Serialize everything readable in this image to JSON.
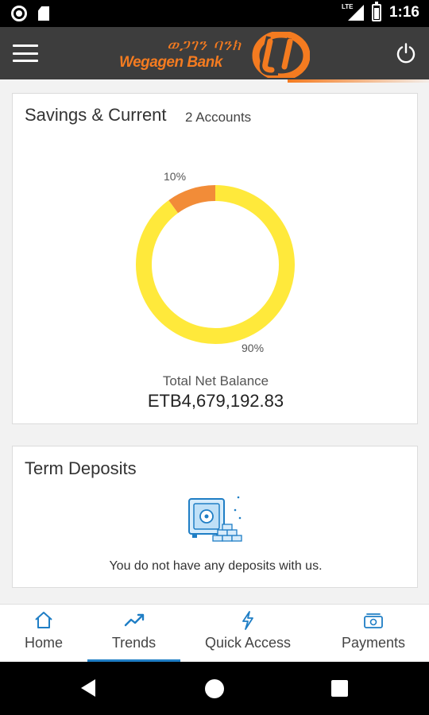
{
  "status_bar": {
    "time": "1:16",
    "network_label": "LTE",
    "icons": [
      "notification-dot-icon",
      "sd-card-icon",
      "lte-signal-icon",
      "battery-icon"
    ]
  },
  "header": {
    "amharic_name": "ወጋገን ባንክ",
    "bank_name": "Wegagen Bank",
    "menu_icon": "hamburger-menu-icon",
    "power_icon": "power-icon",
    "accent_color": "#f47b20",
    "background_color": "#3d3d3d"
  },
  "savings_card": {
    "title": "Savings & Current",
    "subtitle": "2 Accounts",
    "slices": [
      {
        "label": "10%",
        "value": 10,
        "color": "#f28c38"
      },
      {
        "label": "90%",
        "value": 90,
        "color": "#ffe93b"
      }
    ],
    "balance_label": "Total Net Balance",
    "balance_value": "ETB4,679,192.83"
  },
  "term_card": {
    "title": "Term Deposits",
    "icon": "safe-with-gold-bars-icon",
    "empty_message": "You do not have any deposits with us."
  },
  "bottom_nav": {
    "items": [
      {
        "label": "Home",
        "icon": "home-icon"
      },
      {
        "label": "Trends",
        "icon": "trends-icon"
      },
      {
        "label": "Quick Access",
        "icon": "lightning-icon"
      },
      {
        "label": "Payments",
        "icon": "payments-icon"
      }
    ],
    "active_index": 1,
    "active_color": "#1f7ec5",
    "icon_color": "#1f7ec5"
  },
  "system_nav": {
    "icons": [
      "back-icon",
      "home-circle-icon",
      "recent-apps-icon"
    ]
  }
}
